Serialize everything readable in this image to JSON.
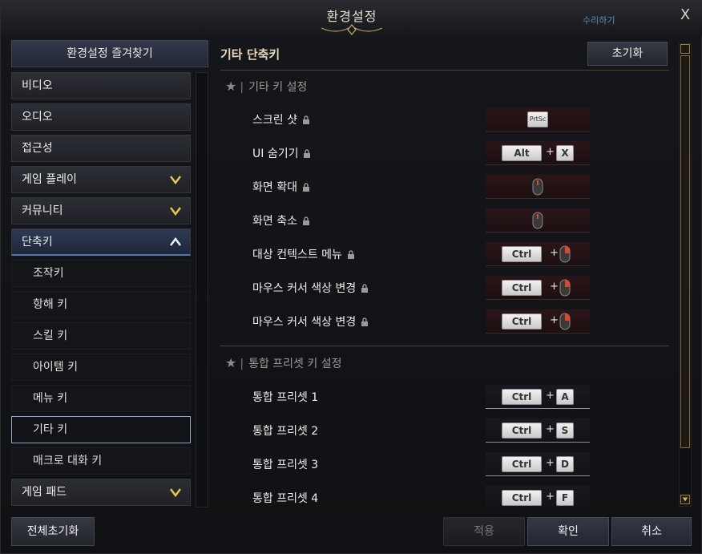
{
  "window": {
    "title": "환경설정",
    "close_label": "X",
    "background_hint": "수리하기"
  },
  "sidebar": {
    "favorites_label": "환경설정 즐겨찾기",
    "items": [
      {
        "label": "비디오"
      },
      {
        "label": "오디오"
      },
      {
        "label": "접근성"
      },
      {
        "label": "게임 플레이",
        "icon": "chevron-down-icon"
      },
      {
        "label": "커뮤니티",
        "icon": "chevron-down-icon"
      },
      {
        "label": "단축키",
        "icon": "chevron-up-icon",
        "state": "expanded"
      },
      {
        "label": "조작키"
      },
      {
        "label": "항해 키"
      },
      {
        "label": "스킬 키"
      },
      {
        "label": "아이템 키"
      },
      {
        "label": "메뉴 키"
      },
      {
        "label": "기타 키",
        "state": "selected"
      },
      {
        "label": "매크로 대화 키"
      },
      {
        "label": "게임 패드",
        "icon": "chevron-down-icon"
      }
    ]
  },
  "panel": {
    "title": "기타 단축키",
    "reset_label": "초기화",
    "groups": [
      {
        "title": "기타 키 설정",
        "rows": [
          {
            "label": "스크린 샷",
            "locked": true,
            "keys": [
              "PrtSc"
            ]
          },
          {
            "label": "UI 숨기기",
            "locked": true,
            "keys": [
              "Alt",
              "X"
            ]
          },
          {
            "label": "화면 확대",
            "locked": true,
            "keys": [
              "mouse-wheel-icon"
            ]
          },
          {
            "label": "화면 축소",
            "locked": true,
            "keys": [
              "mouse-wheel-icon"
            ]
          },
          {
            "label": "대상 컨텍스트 메뉴",
            "locked": true,
            "keys": [
              "Ctrl",
              "mouse-right-icon"
            ]
          },
          {
            "label": "마우스 커서 색상 변경",
            "locked": true,
            "keys": [
              "Ctrl",
              "mouse-right-icon"
            ]
          },
          {
            "label": "마우스 커서 색상 변경",
            "locked": true,
            "keys": [
              "Ctrl",
              "mouse-right-icon"
            ]
          }
        ]
      },
      {
        "title": "통합 프리셋 키 설정",
        "rows": [
          {
            "label": "통합 프리셋 1",
            "keys": [
              "Ctrl",
              "A"
            ]
          },
          {
            "label": "통합 프리셋 2",
            "keys": [
              "Ctrl",
              "S"
            ]
          },
          {
            "label": "통합 프리셋 3",
            "keys": [
              "Ctrl",
              "D"
            ]
          },
          {
            "label": "통합 프리셋 4",
            "keys": [
              "Ctrl",
              "F"
            ]
          }
        ]
      }
    ],
    "plus": "+"
  },
  "footer": {
    "reset_all_label": "전체초기화",
    "apply_label": "적용",
    "ok_label": "확인",
    "cancel_label": "취소"
  },
  "colors": {
    "accent_gold": "#e4d9b9",
    "selected_border": "#8aa6c8",
    "active_underline": "#4f76b8",
    "locked_slot": "#2a1518"
  }
}
